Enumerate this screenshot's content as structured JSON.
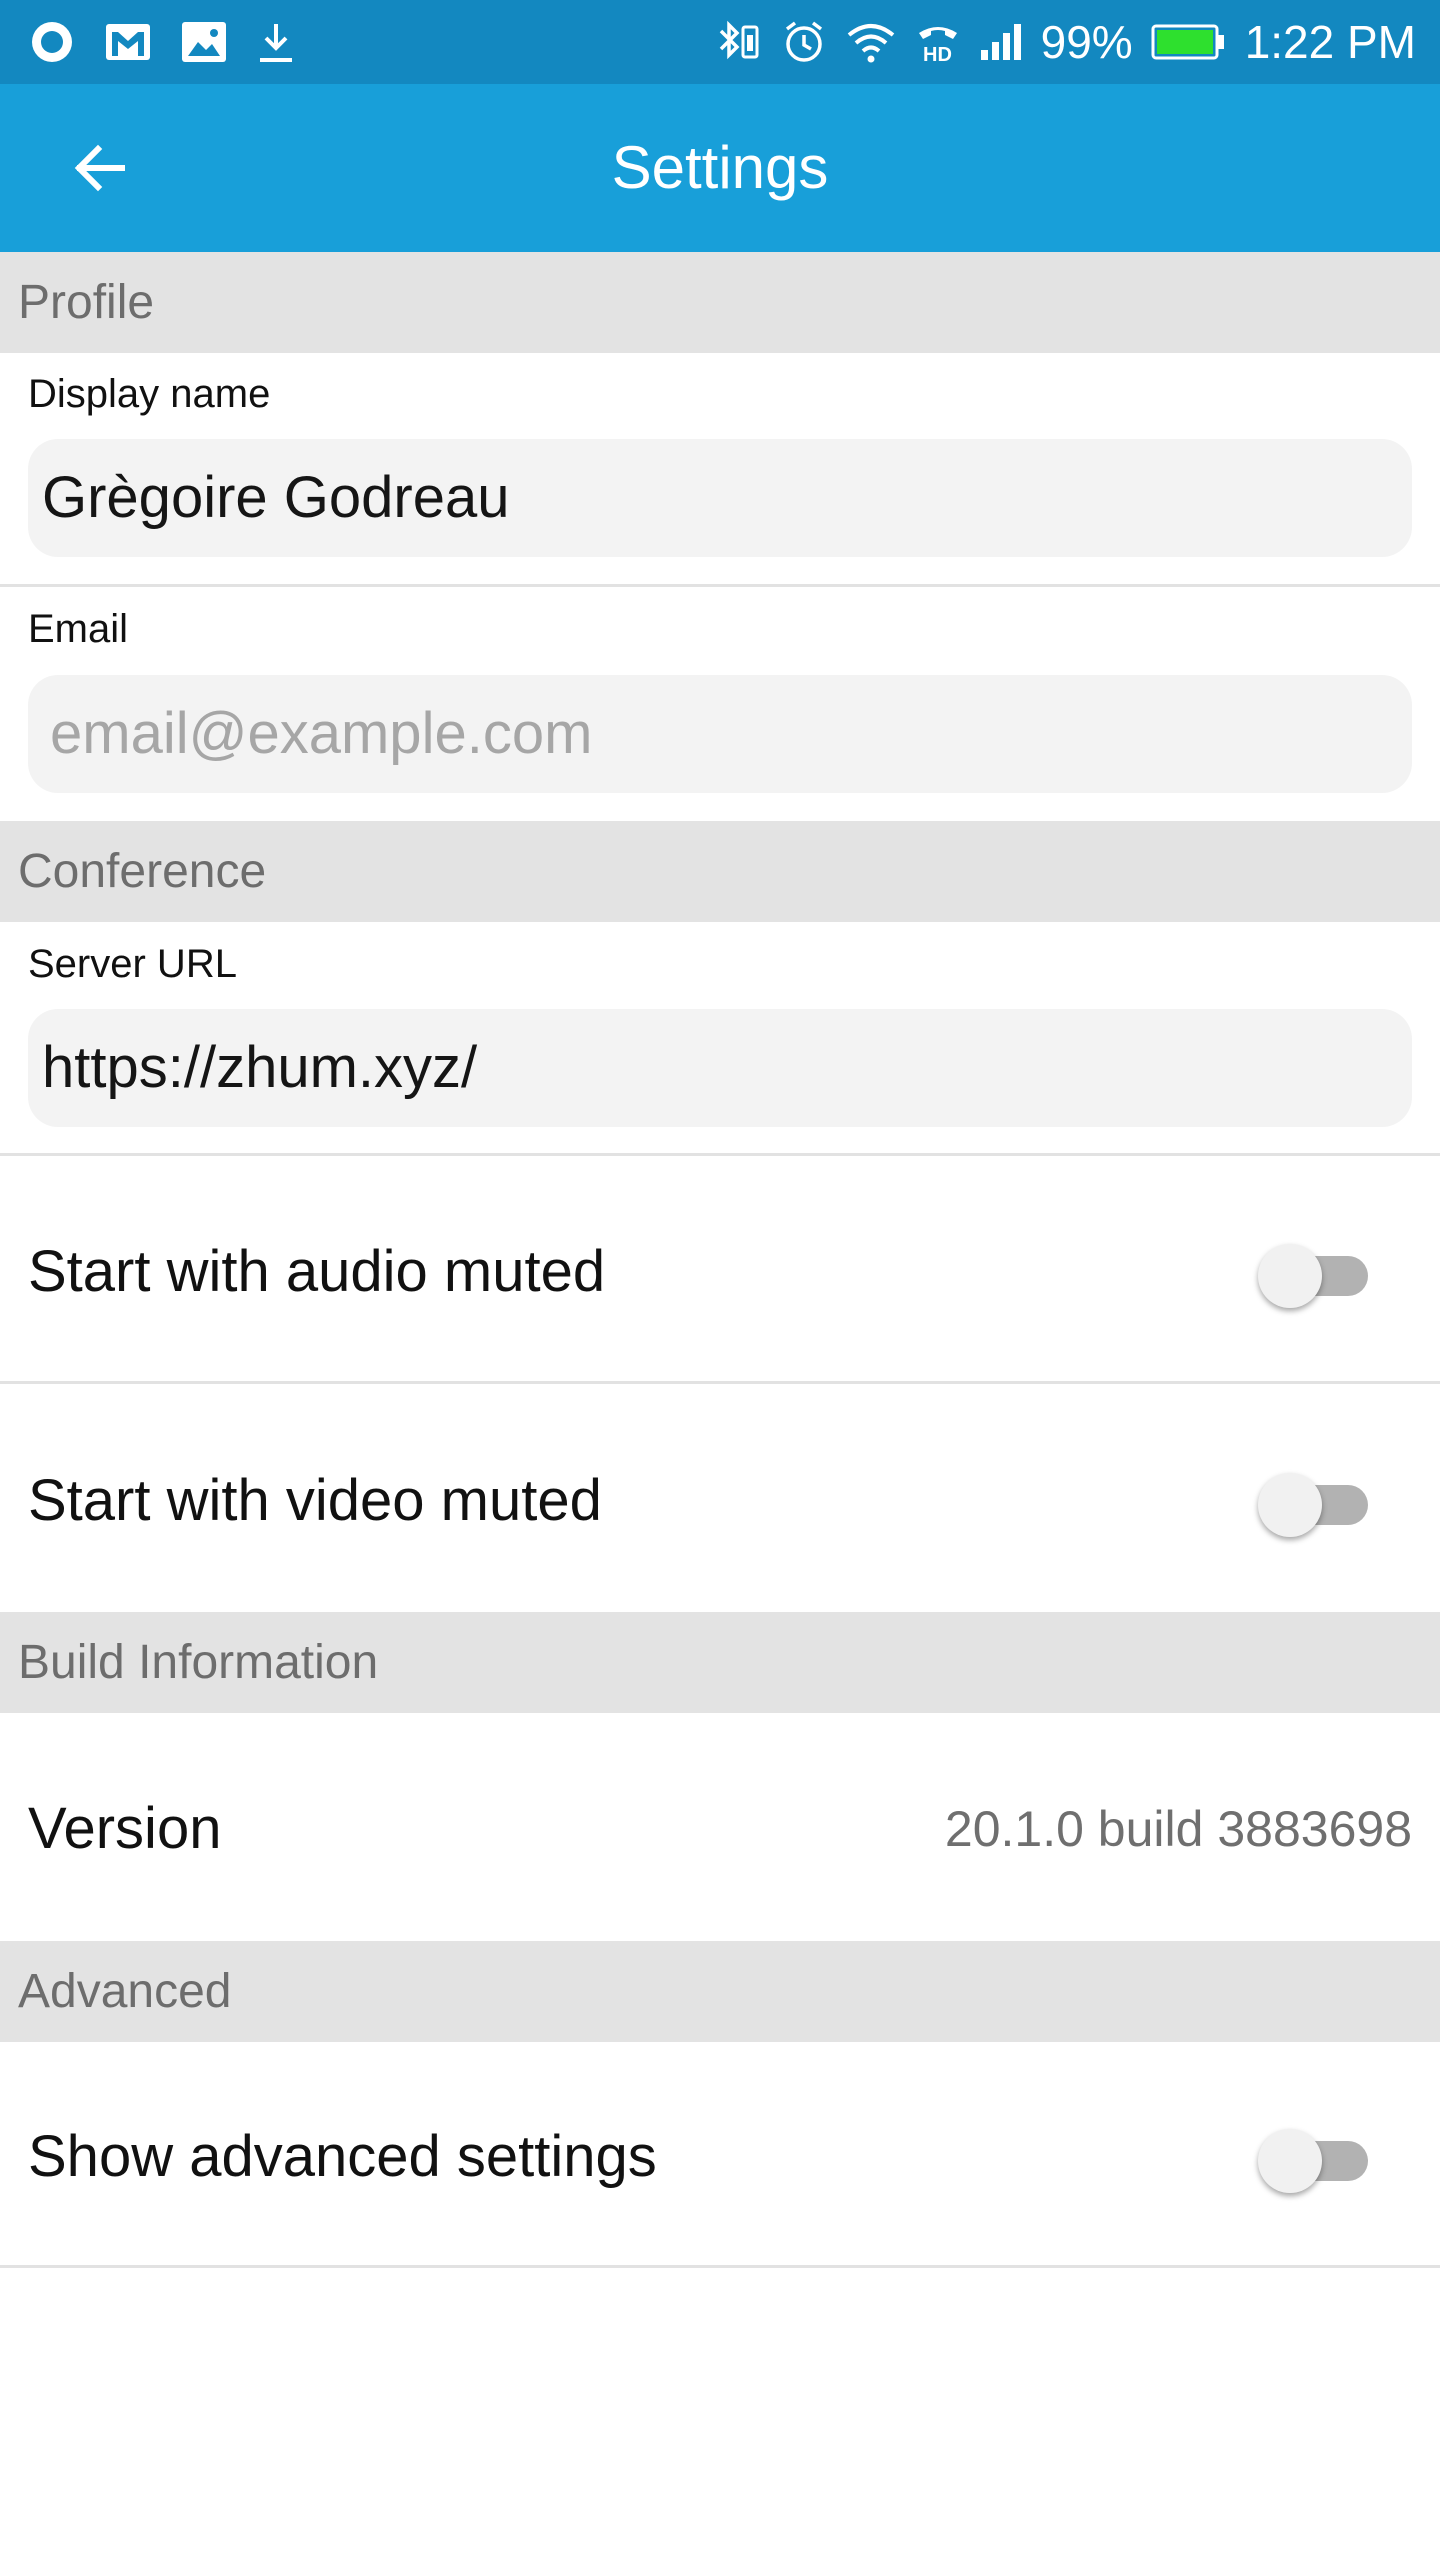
{
  "status_bar": {
    "battery": "99%",
    "time": "1:22 PM",
    "left_icons": [
      "circle-app-icon",
      "gmail-icon",
      "image-icon",
      "download-icon"
    ],
    "right_icons": [
      "bluetooth-icon",
      "alarm-icon",
      "wifi-icon",
      "hd-call-icon",
      "signal-icon",
      "battery-icon"
    ]
  },
  "app_bar": {
    "title": "Settings",
    "back_icon": "arrow-left-icon"
  },
  "profile": {
    "header": "Profile",
    "display_name_label": "Display name",
    "display_name_value": "Grègoire Godreau",
    "email_label": "Email",
    "email_placeholder": "email@example.com"
  },
  "conference": {
    "header": "Conference",
    "server_url_label": "Server URL",
    "server_url_value": "https://zhum.xyz/",
    "audio_muted_label": "Start with audio muted",
    "audio_muted_on": false,
    "video_muted_label": "Start with video muted",
    "video_muted_on": false
  },
  "build_info": {
    "header": "Build Information",
    "version_label": "Version",
    "version_value": "20.1.0 build 3883698"
  },
  "advanced": {
    "header": "Advanced",
    "show_advanced_label": "Show advanced settings",
    "show_advanced_on": false
  },
  "colors": {
    "status_bar": "#1388c0",
    "app_bar": "#189fd9",
    "section_header_bg": "#e3e3e3",
    "field_bg": "#f3f3f3",
    "toggle_track_off": "#b2b2b2"
  }
}
